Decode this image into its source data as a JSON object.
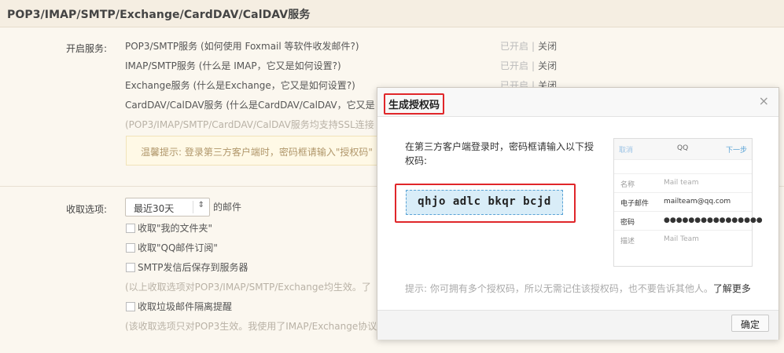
{
  "header": {
    "title": "POP3/IMAP/SMTP/Exchange/CardDAV/CalDAV服务"
  },
  "services": {
    "label": "开启服务:",
    "items": [
      {
        "name": "POP3/SMTP服务",
        "note": "(如何使用 Foxmail 等软件收发邮件?)",
        "on": "已开启",
        "sep": "|",
        "off": "关闭"
      },
      {
        "name": "IMAP/SMTP服务",
        "note": "(什么是 IMAP，它又是如何设置?)",
        "on": "已开启",
        "sep": "|",
        "off": "关闭"
      },
      {
        "name": "Exchange服务",
        "note": "(什么是Exchange，它又是如何设置?)",
        "on": "已开启",
        "sep": "|",
        "off": "关闭"
      },
      {
        "name": "CardDAV/CalDAV服务",
        "note": "(什么是CardDAV/CalDAV，它又是",
        "on": "",
        "sep": "",
        "off": ""
      }
    ],
    "ssl_note": "(POP3/IMAP/SMTP/CardDAV/CalDAV服务均支持SSL连接",
    "tip": "温馨提示: 登录第三方客户端时，密码框请输入\"授权码\""
  },
  "receive": {
    "label": "收取选项:",
    "select_value": "最近30天",
    "select_suffix": "的邮件",
    "options": [
      "收取\"我的文件夹\"",
      "收取\"QQ邮件订阅\"",
      "SMTP发信后保存到服务器"
    ],
    "note1": "(以上收取选项对POP3/IMAP/SMTP/Exchange均生效。了",
    "spam_option": "收取垃圾邮件隔离提醒",
    "note2": "(该收取选项只对POP3生效。我使用了IMAP/Exchange协议"
  },
  "dialog": {
    "title": "生成授权码",
    "close": "×",
    "message": "在第三方客户端登录时，密码框请输入以下授权码:",
    "code": "qhjo adlc bkqr bcjd",
    "phone": {
      "cancel": "取消",
      "title": "QQ",
      "next": "下一步",
      "rows": [
        {
          "key": "名称",
          "value": "Mail team"
        },
        {
          "key": "电子邮件",
          "value": "mailteam@qq.com"
        },
        {
          "key": "密码",
          "value": "●●●●●●●●●●●●●●●●"
        },
        {
          "key": "描述",
          "value": "Mail Team"
        }
      ]
    },
    "hint": "提示: 你可拥有多个授权码，所以无需记住该授权码，也不要告诉其他人。",
    "learn_more": "了解更多",
    "ok": "确定"
  }
}
